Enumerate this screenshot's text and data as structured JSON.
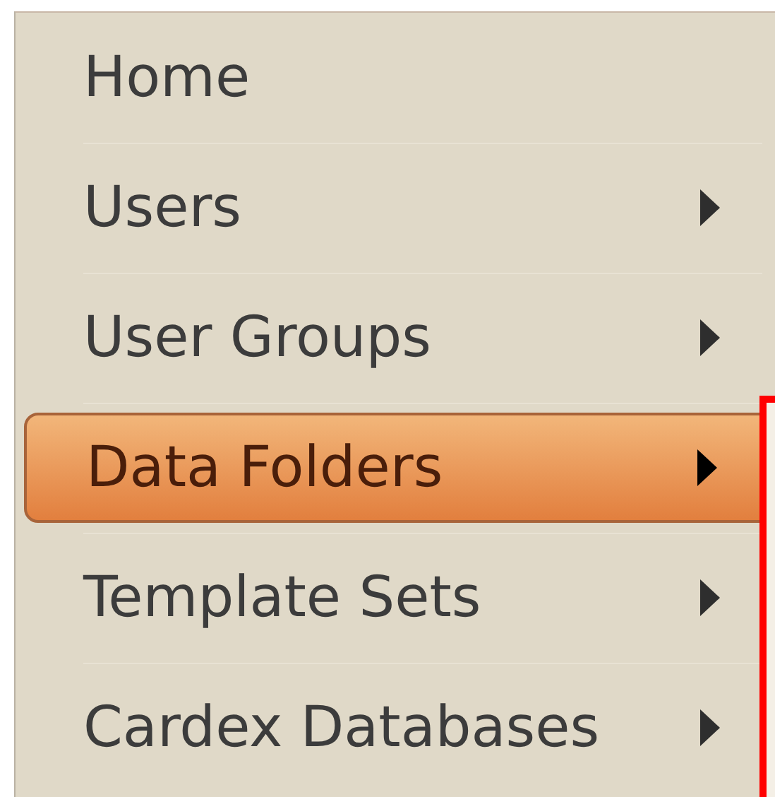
{
  "menu": {
    "items": [
      {
        "label": "Home",
        "has_submenu": false,
        "selected": false
      },
      {
        "label": "Users",
        "has_submenu": true,
        "selected": false
      },
      {
        "label": "User Groups",
        "has_submenu": true,
        "selected": false
      },
      {
        "label": "Data Folders",
        "has_submenu": true,
        "selected": true
      },
      {
        "label": "Template Sets",
        "has_submenu": true,
        "selected": false
      },
      {
        "label": "Cardex Databases",
        "has_submenu": true,
        "selected": false
      }
    ]
  }
}
